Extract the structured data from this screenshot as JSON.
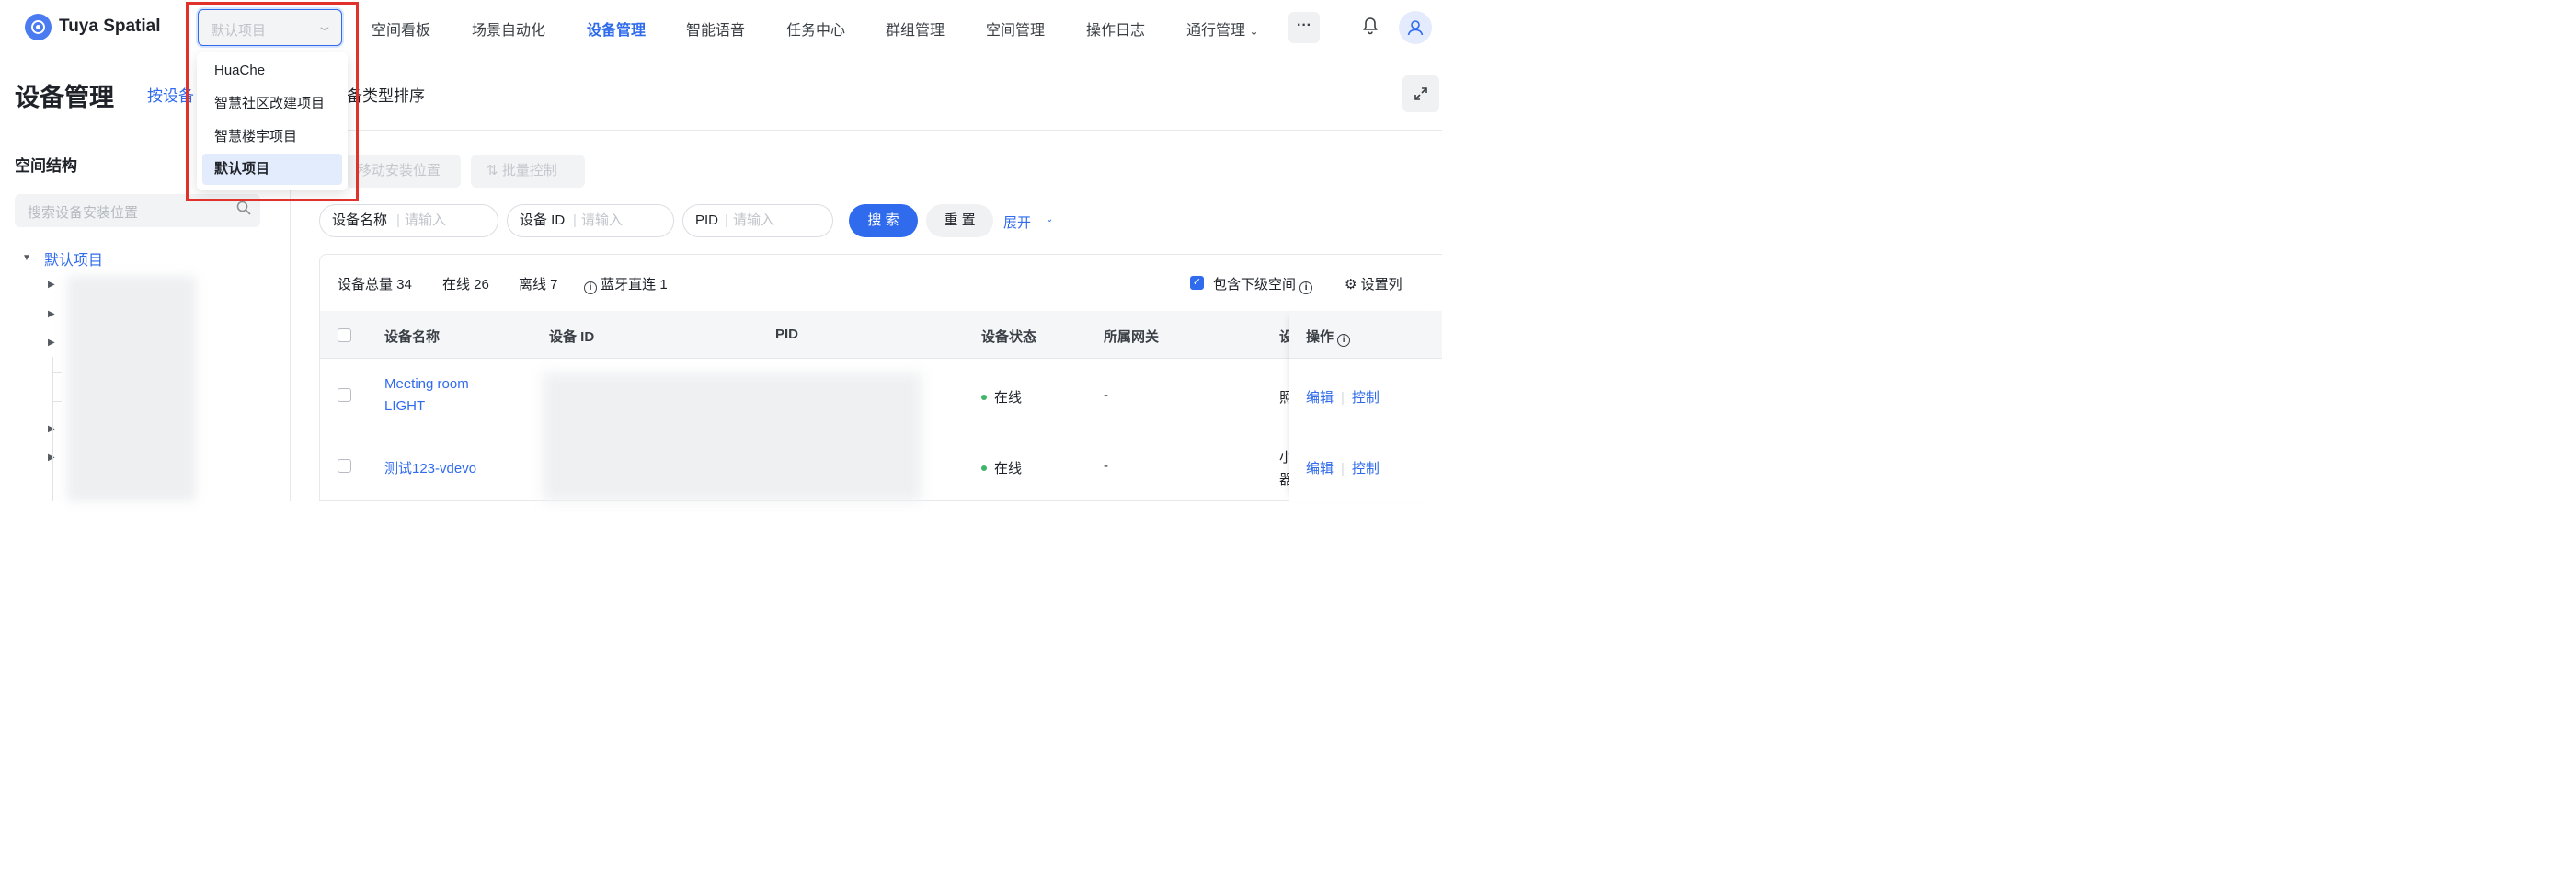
{
  "brand": "Tuya Spatial",
  "project_select": {
    "value": "默认项目"
  },
  "nav": [
    "空间看板",
    "场景自动化",
    "设备管理",
    "智能语音",
    "任务中心",
    "群组管理",
    "空间管理",
    "操作日志",
    "通行管理"
  ],
  "nav_more": "···",
  "page": {
    "title": "设备管理",
    "sort_tab_1": "按设备",
    "sort_tab_2": "备类型排序"
  },
  "sidebar": {
    "title": "空间结构",
    "search_placeholder": "搜索设备安装位置",
    "root": "默认项目"
  },
  "toolbar": {
    "move_label": "移动安装位置",
    "batch_label": "批量控制"
  },
  "filters": {
    "name_label": "设备名称",
    "id_label": "设备 ID",
    "pid_label": "PID",
    "placeholder": "请输入",
    "search_btn": "搜 索",
    "reset_btn": "重 置",
    "expand_btn": "展开"
  },
  "stats": {
    "total": "设备总量 34",
    "online": "在线 26",
    "offline": "离线 7",
    "bluetooth": "蓝牙直连 1",
    "include_sub": "包含下级空间",
    "set_columns": "设置列"
  },
  "table": {
    "headers": [
      "设备名称",
      "设备 ID",
      "PID",
      "设备状态",
      "所属网关",
      "设",
      "操作"
    ],
    "rows": [
      {
        "name_line1": "Meeting room",
        "name_line2": "LIGHT",
        "status": "在线",
        "gateway": "-",
        "type_partial": "照",
        "edit": "编辑",
        "control": "控制"
      },
      {
        "name_line1": "测试123-vdevo",
        "status": "在线",
        "gateway": "-",
        "type_partial_1": "小",
        "type_partial_2": "器",
        "edit": "编辑",
        "control": "控制"
      }
    ]
  },
  "dropdown": {
    "options": [
      "HuaChe",
      "智慧社区改建项目",
      "智慧楼宇项目",
      "默认项目"
    ],
    "selected_index": 3
  },
  "colors": {
    "accent": "#2f6bec",
    "online": "#3fb56a",
    "highlight": "#e0322b"
  }
}
